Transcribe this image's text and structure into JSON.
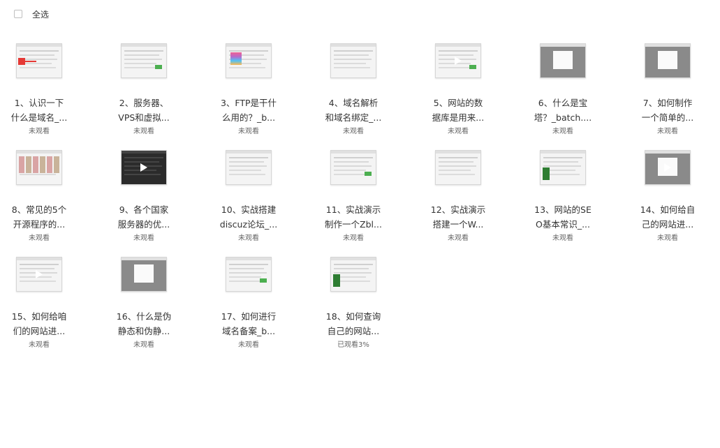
{
  "toolbar": {
    "select_all_label": "全选"
  },
  "videos": [
    {
      "title_line1": "1、认识一下",
      "title_line2": "什么是域名_...",
      "status": "未观看"
    },
    {
      "title_line1": "2、服务器、",
      "title_line2": "VPS和虚拟...",
      "status": "未观看"
    },
    {
      "title_line1": "3、FTP是干什",
      "title_line2": "么用的？_b...",
      "status": "未观看"
    },
    {
      "title_line1": "4、域名解析",
      "title_line2": "和域名绑定_...",
      "status": "未观看"
    },
    {
      "title_line1": "5、网站的数",
      "title_line2": "据库是用来...",
      "status": "未观看"
    },
    {
      "title_line1": "6、什么是宝",
      "title_line2": "塔？_batch....",
      "status": "未观看"
    },
    {
      "title_line1": "7、如何制作",
      "title_line2": "一个简单的...",
      "status": "未观看"
    },
    {
      "title_line1": "8、常见的5个",
      "title_line2": "开源程序的...",
      "status": "未观看"
    },
    {
      "title_line1": "9、各个国家",
      "title_line2": "服务器的优...",
      "status": "未观看"
    },
    {
      "title_line1": "10、实战搭建",
      "title_line2": "discuz论坛_...",
      "status": "未观看"
    },
    {
      "title_line1": "11、实战演示",
      "title_line2": "制作一个Zbl...",
      "status": "未观看"
    },
    {
      "title_line1": "12、实战演示",
      "title_line2": "搭建一个W...",
      "status": "未观看"
    },
    {
      "title_line1": "13、网站的SE",
      "title_line2": "O基本常识_...",
      "status": "未观看"
    },
    {
      "title_line1": "14、如何给自",
      "title_line2": "己的网站进...",
      "status": "未观看"
    },
    {
      "title_line1": "15、如何给咱",
      "title_line2": "们的网站进...",
      "status": "未观看"
    },
    {
      "title_line1": "16、什么是伪",
      "title_line2": "静态和伪静...",
      "status": "未观看"
    },
    {
      "title_line1": "17、如何进行",
      "title_line2": "域名备案_b...",
      "status": "未观看"
    },
    {
      "title_line1": "18、如何查询",
      "title_line2": "自己的网站...",
      "status": "已观看3%"
    }
  ],
  "thumb_styles": [
    "red",
    "light",
    "colorful",
    "light",
    "light",
    "gray",
    "gray",
    "photo",
    "dark",
    "light",
    "light",
    "light",
    "web",
    "gray",
    "light",
    "gray",
    "light",
    "web"
  ],
  "thumb_play": [
    false,
    false,
    false,
    false,
    true,
    false,
    false,
    false,
    true,
    false,
    false,
    false,
    false,
    true,
    true,
    false,
    false,
    false
  ],
  "colors": {
    "accent_red": "#e53935",
    "accent_green": "#4caf50",
    "status_gray": "#666666"
  }
}
